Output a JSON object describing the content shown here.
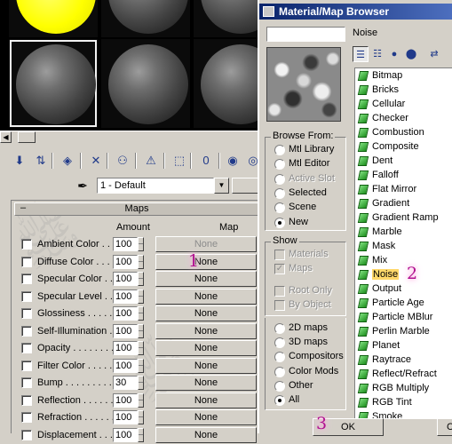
{
  "material_editor": {
    "slots": [
      {
        "color": "yellow",
        "active": false
      },
      {
        "color": "gray",
        "active": false
      },
      {
        "color": "gray",
        "active": false
      },
      {
        "color": "gray",
        "active": true
      },
      {
        "color": "gray",
        "active": false
      },
      {
        "color": "gray",
        "active": false
      }
    ],
    "toolbar_icons": [
      "get-material-icon",
      "put-to-scene-icon",
      "assign-to-selection-icon",
      "reset-icon",
      "make-copy-icon",
      "make-unique-icon",
      "put-to-library-icon",
      "material-id-icon",
      "show-map-icon",
      "show-end-result-icon"
    ],
    "material_name": "1 - Default",
    "maps_rollout": {
      "title": "Maps",
      "collapse_symbol": "–",
      "col_amount": "Amount",
      "col_map": "Map",
      "rows": [
        {
          "label": "Ambient Color . . . .",
          "amount": "100",
          "map": "None",
          "disabled": true
        },
        {
          "label": "Diffuse Color . . . .",
          "amount": "100",
          "map": "None",
          "disabled": false
        },
        {
          "label": "Specular Color . . .",
          "amount": "100",
          "map": "None",
          "disabled": false
        },
        {
          "label": "Specular Level . . .",
          "amount": "100",
          "map": "None",
          "disabled": false
        },
        {
          "label": "Glossiness . . . . . .",
          "amount": "100",
          "map": "None",
          "disabled": false
        },
        {
          "label": "Self-Illumination . .",
          "amount": "100",
          "map": "None",
          "disabled": false
        },
        {
          "label": "Opacity . . . . . . . .",
          "amount": "100",
          "map": "None",
          "disabled": false
        },
        {
          "label": "Filter Color . . . . .",
          "amount": "100",
          "map": "None",
          "disabled": false
        },
        {
          "label": "Bump . . . . . . . . .",
          "amount": "30",
          "map": "None",
          "disabled": false
        },
        {
          "label": "Reflection . . . . . .",
          "amount": "100",
          "map": "None",
          "disabled": false
        },
        {
          "label": "Refraction . . . . . .",
          "amount": "100",
          "map": "None",
          "disabled": false
        },
        {
          "label": "Displacement . . .",
          "amount": "100",
          "map": "None",
          "disabled": false
        }
      ]
    }
  },
  "browser": {
    "title": "Material/Map Browser",
    "selected_name": "Noise",
    "browse_from": {
      "title": "Browse From:",
      "options": [
        {
          "label": "Mtl Library",
          "selected": false,
          "disabled": false
        },
        {
          "label": "Mtl Editor",
          "selected": false,
          "disabled": false
        },
        {
          "label": "Active Slot",
          "selected": false,
          "disabled": true
        },
        {
          "label": "Selected",
          "selected": false,
          "disabled": false
        },
        {
          "label": "Scene",
          "selected": false,
          "disabled": false
        },
        {
          "label": "New",
          "selected": true,
          "disabled": false
        }
      ]
    },
    "show": {
      "title": "Show",
      "checkboxes": [
        {
          "label": "Materials",
          "checked": false
        },
        {
          "label": "Maps",
          "checked": true
        },
        {
          "label": "Root Only",
          "checked": false
        },
        {
          "label": "By Object",
          "checked": false
        }
      ]
    },
    "map_filter": [
      {
        "label": "2D maps",
        "selected": false
      },
      {
        "label": "3D maps",
        "selected": false
      },
      {
        "label": "Compositors",
        "selected": false
      },
      {
        "label": "Color Mods",
        "selected": false
      },
      {
        "label": "Other",
        "selected": false
      },
      {
        "label": "All",
        "selected": true
      }
    ],
    "maps": [
      "Bitmap",
      "Bricks",
      "Cellular",
      "Checker",
      "Combustion",
      "Composite",
      "Dent",
      "Falloff",
      "Flat Mirror",
      "Gradient",
      "Gradient Ramp",
      "Marble",
      "Mask",
      "Mix",
      "Noise",
      "Output",
      "Particle Age",
      "Particle MBlur",
      "Perlin Marble",
      "Planet",
      "Raytrace",
      "Reflect/Refract",
      "RGB Multiply",
      "RGB Tint",
      "Smoke"
    ],
    "selected_map": "Noise",
    "ok_label": "OK",
    "cancel_label": "Ca"
  },
  "annotations": {
    "step1": "1",
    "step2": "2",
    "step3": "3"
  },
  "colors": {
    "titlebar": "#0a246a",
    "map_icon": "#2fbf2f",
    "highlight": "#ffd86a",
    "annotation": "#b01090"
  }
}
